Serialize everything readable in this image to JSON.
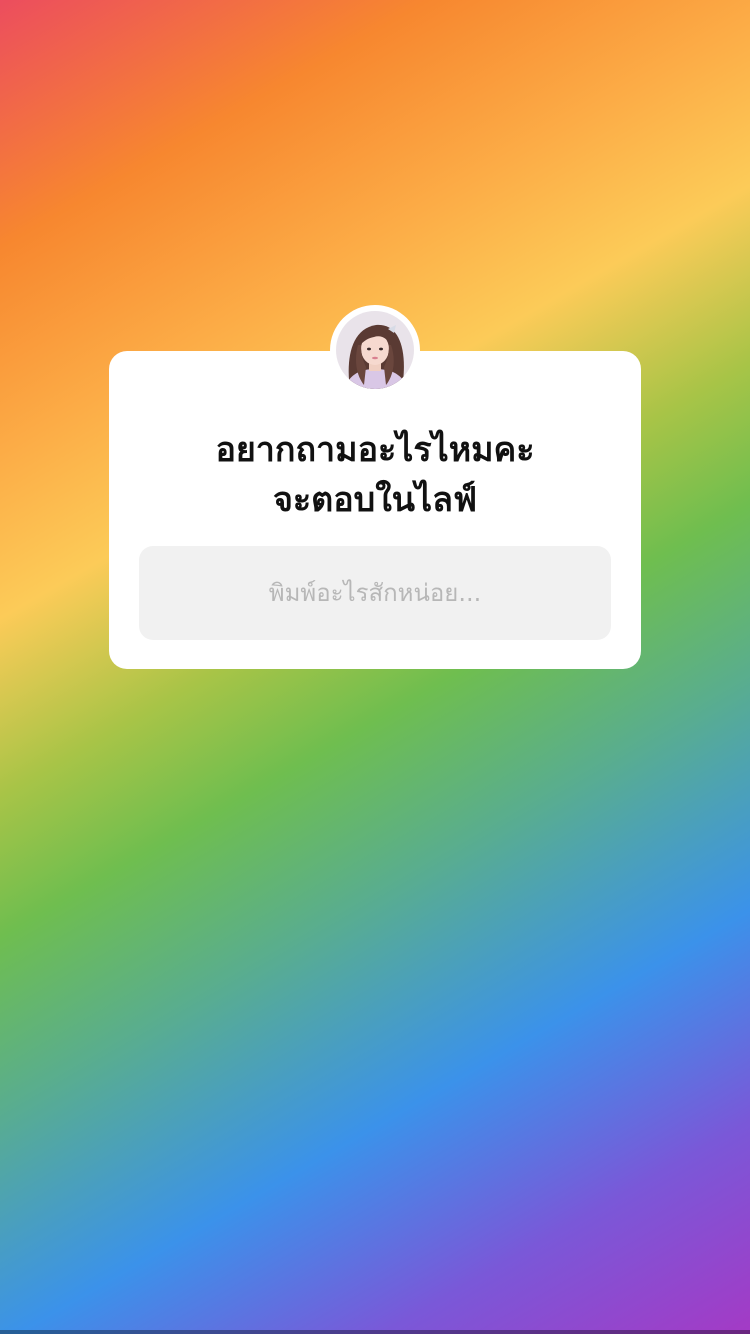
{
  "story": {
    "background_gradient_colors": [
      "#ec4d5e",
      "#f7872f",
      "#fccb58",
      "#6fbe4f",
      "#3b92ea",
      "#a43ac5"
    ]
  },
  "question_sticker": {
    "avatar_icon": "profile-avatar",
    "question_lines": [
      "อยากถามอะไรไหมคะ",
      "จะตอบในไลฟ์"
    ],
    "answer_placeholder": "พิมพ์อะไรสักหน่อย...",
    "answer_value": ""
  }
}
